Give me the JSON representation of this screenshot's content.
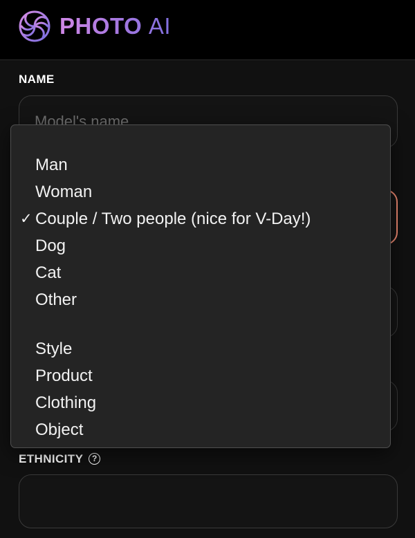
{
  "header": {
    "brand_photo": "PHOTO",
    "brand_ai": "AI",
    "brand_tm": "™"
  },
  "form": {
    "name_label": "NAME",
    "name_placeholder": "Model's name",
    "ethnicity_label": "ETHNICITY",
    "ethnicity_value": ""
  },
  "dropdown": {
    "group1": [
      {
        "label": "Man",
        "selected": false
      },
      {
        "label": "Woman",
        "selected": false
      },
      {
        "label": "Couple / Two people (nice for V-Day!)",
        "selected": true
      },
      {
        "label": "Dog",
        "selected": false
      },
      {
        "label": "Cat",
        "selected": false
      },
      {
        "label": "Other",
        "selected": false
      }
    ],
    "group2": [
      {
        "label": "Style"
      },
      {
        "label": "Product"
      },
      {
        "label": "Clothing"
      },
      {
        "label": "Object"
      }
    ],
    "check_glyph": "✓"
  },
  "colors": {
    "accent_border": "#f08a72",
    "brand_gradient_start": "#cf88e6",
    "brand_gradient_end": "#7a6fe0"
  },
  "icons": {
    "logo": "photo-ai-logo-icon",
    "help": "question-circle-icon",
    "check": "checkmark-icon"
  }
}
